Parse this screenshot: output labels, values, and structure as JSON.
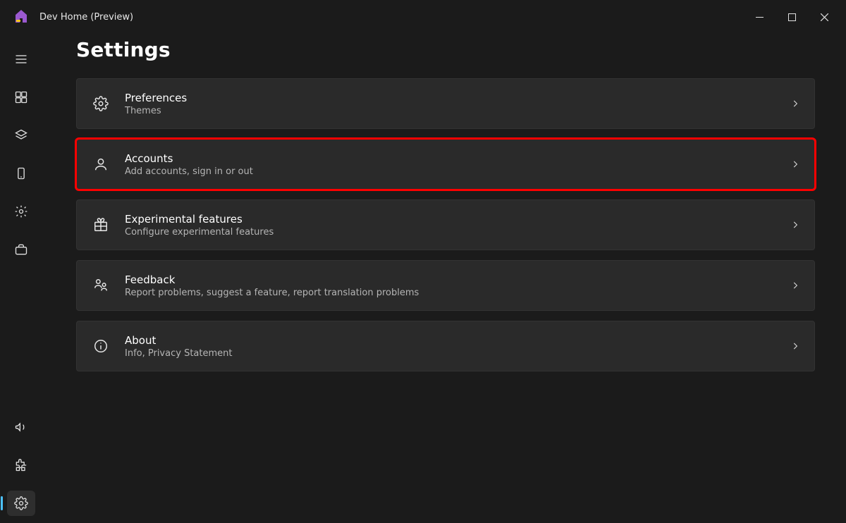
{
  "window": {
    "title": "Dev Home (Preview)"
  },
  "page": {
    "title": "Settings"
  },
  "settings_items": [
    {
      "id": "preferences",
      "title": "Preferences",
      "subtitle": "Themes",
      "icon": "gear",
      "highlighted": false
    },
    {
      "id": "accounts",
      "title": "Accounts",
      "subtitle": "Add accounts, sign in or out",
      "icon": "person",
      "highlighted": true
    },
    {
      "id": "experimental",
      "title": "Experimental features",
      "subtitle": "Configure experimental features",
      "icon": "gift",
      "highlighted": false
    },
    {
      "id": "feedback",
      "title": "Feedback",
      "subtitle": "Report problems, suggest a feature, report translation problems",
      "icon": "feedback",
      "highlighted": false
    },
    {
      "id": "about",
      "title": "About",
      "subtitle": "Info, Privacy Statement",
      "icon": "info",
      "highlighted": false
    }
  ],
  "nav_rail": {
    "top_items": [
      "hamburger",
      "dashboard",
      "layers",
      "device",
      "machine-config",
      "toolbox"
    ],
    "bottom_items": [
      "megaphone",
      "extensions",
      "settings"
    ],
    "selected": "settings"
  }
}
